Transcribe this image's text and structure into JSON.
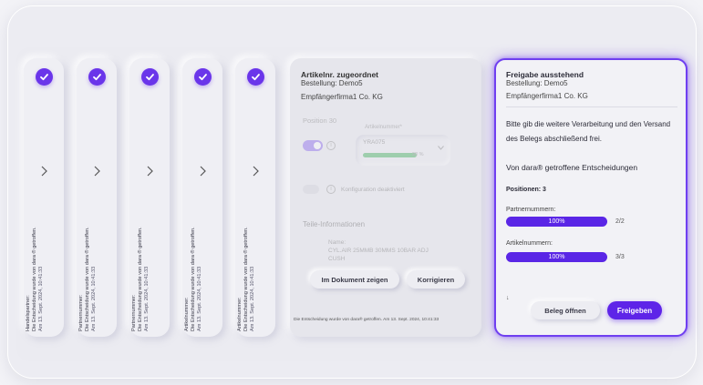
{
  "colors": {
    "accent": "#5e24e8",
    "check": "#6a35ea",
    "progress_green": "#2aa84a"
  },
  "decision_cards": [
    {
      "line1": "Handelspartner:",
      "line2": "Die Entscheidung wurde von dara ® getroffen.",
      "date": "Am 13. Sept. 2024, 10:41:33"
    },
    {
      "line1": "Partnernummer:",
      "line2": "Die Entscheidung wurde von dara ® getroffen.",
      "date": "Am 13. Sept. 2024, 10:41:33"
    },
    {
      "line1": "Partnernummer:",
      "line2": "Die Entscheidung wurde von dara ® getroffen.",
      "date": "Am 13. Sept. 2024, 10:41:33"
    },
    {
      "line1": "Artikelnummer:",
      "line2": "Die Entscheidung wurde von dara ® getroffen.",
      "date": "Am 13. Sept. 2024, 10:41:33"
    },
    {
      "line1": "Artikelnummer:",
      "line2": "Die Entscheidung wurde von dara ® getroffen.",
      "date": "Am 13. Sept. 2024, 10:41:33"
    }
  ],
  "detail": {
    "title": "Artikelnr. zugeordnet",
    "order": "Bestellung: Demo5",
    "firm": "Empfängerfirma1 Co. KG",
    "position": "Position 30",
    "article_label": "Artikelnummer*",
    "article_value": "YRA075",
    "article_pct": "98 %",
    "article_pct_value": 0.98,
    "config": "Konfiguration deaktiviert",
    "parts_heading": "Teile-Informationen",
    "name_label": "Name:",
    "name_value": "CYL.AIR 25MMB 30MMS 10BAR ADJ",
    "name_value2": "CUSH",
    "btn_show": "Im Dokument zeigen",
    "btn_correct": "Korrigieren",
    "footer": "Die Entscheidung wurde von dara® getroffen. Am 13. Sept. 2024, 10:41:33"
  },
  "release": {
    "title": "Freigabe ausstehend",
    "order": "Bestellung: Demo5",
    "firm": "Empfängerfirma1 Co. KG",
    "message": "Bitte gib die weitere Verarbeitung und den Versand des Belegs abschließend frei.",
    "decisions_heading": "Von dara® getroffene Entscheidungen",
    "positions": "Positionen: 3",
    "partner_label": "Partnernummern:",
    "partner_pct": "100%",
    "partner_pct_value": 1.0,
    "partner_count": "2/2",
    "article_label": "Artikelnummern:",
    "article_pct": "100%",
    "article_pct_value": 1.0,
    "article_count": "3/3",
    "arrow": "↓",
    "btn_open": "Beleg öffnen",
    "btn_release": "Freigeben"
  }
}
